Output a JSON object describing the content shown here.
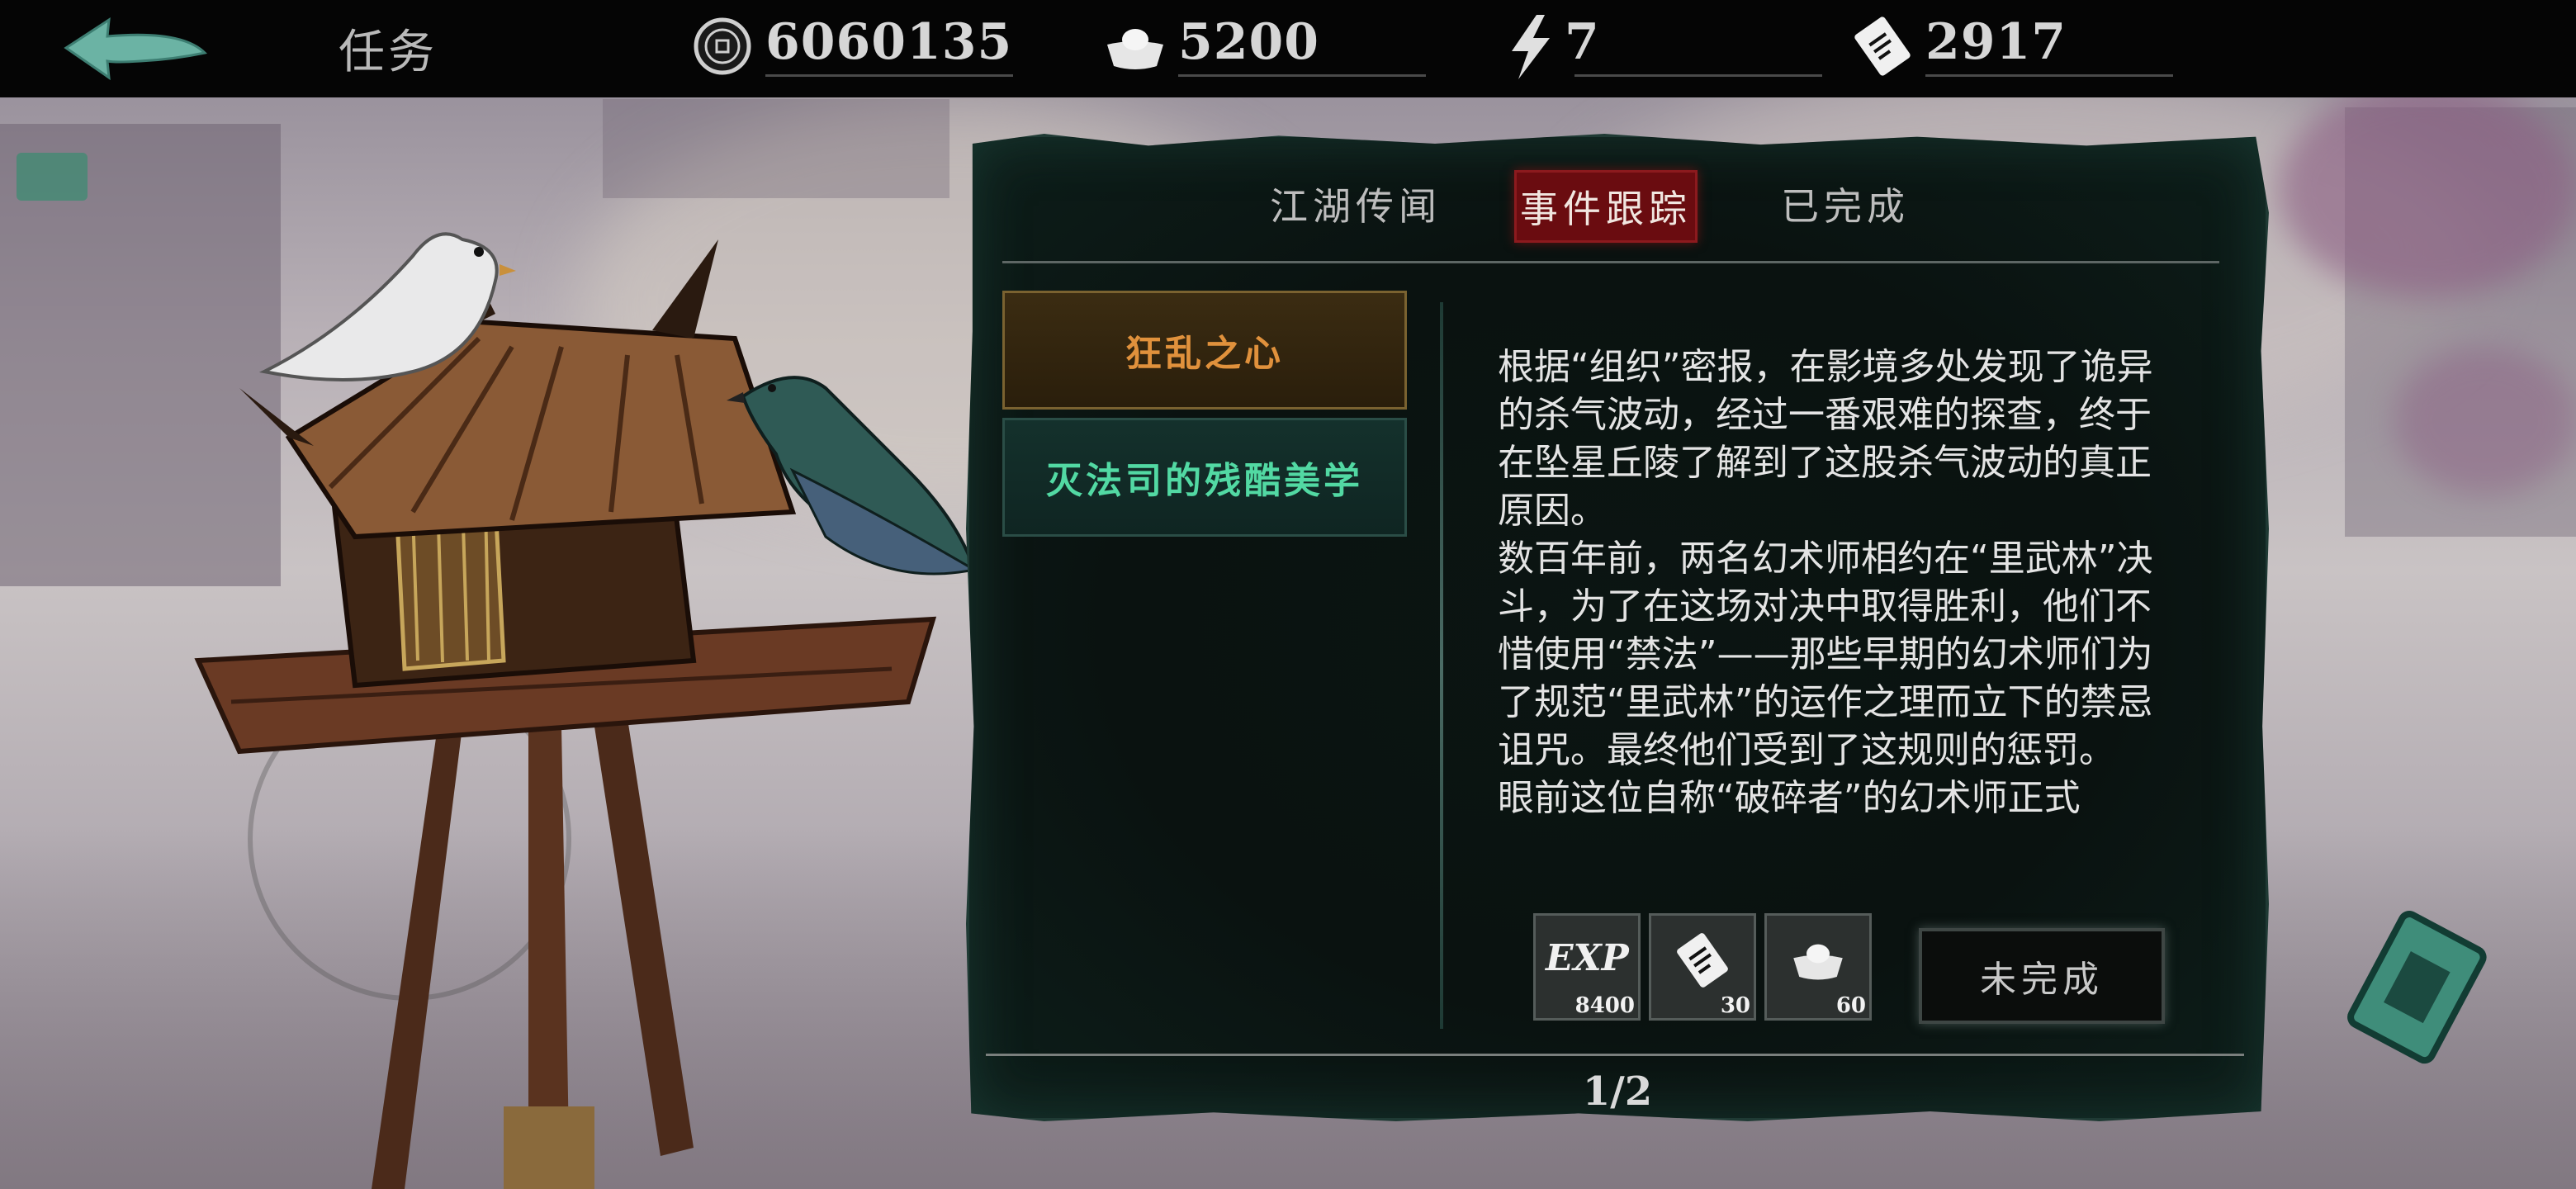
{
  "header": {
    "title": "任务",
    "resources": [
      {
        "icon": "coin-icon",
        "value": "6060135"
      },
      {
        "icon": "silver-ingot-icon",
        "value": "5200"
      },
      {
        "icon": "lightning-icon",
        "value": "7"
      },
      {
        "icon": "ticket-icon",
        "value": "2917"
      }
    ]
  },
  "tabs": [
    {
      "label": "江湖传闻",
      "active": false
    },
    {
      "label": "事件跟踪",
      "active": true
    },
    {
      "label": "已完成",
      "active": false
    }
  ],
  "quests": [
    {
      "label": "狂乱之心",
      "selected": true
    },
    {
      "label": "灭法司的残酷美学",
      "selected": false
    }
  ],
  "description": "根据“组织”密报，在影境多处发现了诡异的杀气波动，经过一番艰难的探查，终于在坠星丘陵了解到了这股杀气波动的真正原因。\n数百年前，两名幻术师相约在“里武林”决斗，为了在这场对决中取得胜利，他们不惜使用“禁法”——那些早期的幻术师们为了规范“里武林”的运作之理而立下的禁忌诅咒。最终他们受到了这规则的惩罚。\n眼前这位自称“破碎者”的幻术师正式",
  "rewards": [
    {
      "icon": "exp-icon",
      "label": "EXP",
      "amount": "8400"
    },
    {
      "icon": "ticket-icon",
      "amount": "30"
    },
    {
      "icon": "silver-ingot-icon",
      "amount": "60"
    }
  ],
  "status_button": "未完成",
  "pager": "1/2",
  "colors": {
    "active_tab": "#6a0c10",
    "selected_quest_text": "#e0913c",
    "quest_text": "#52d9a3",
    "panel_bg": "#0a1210"
  }
}
